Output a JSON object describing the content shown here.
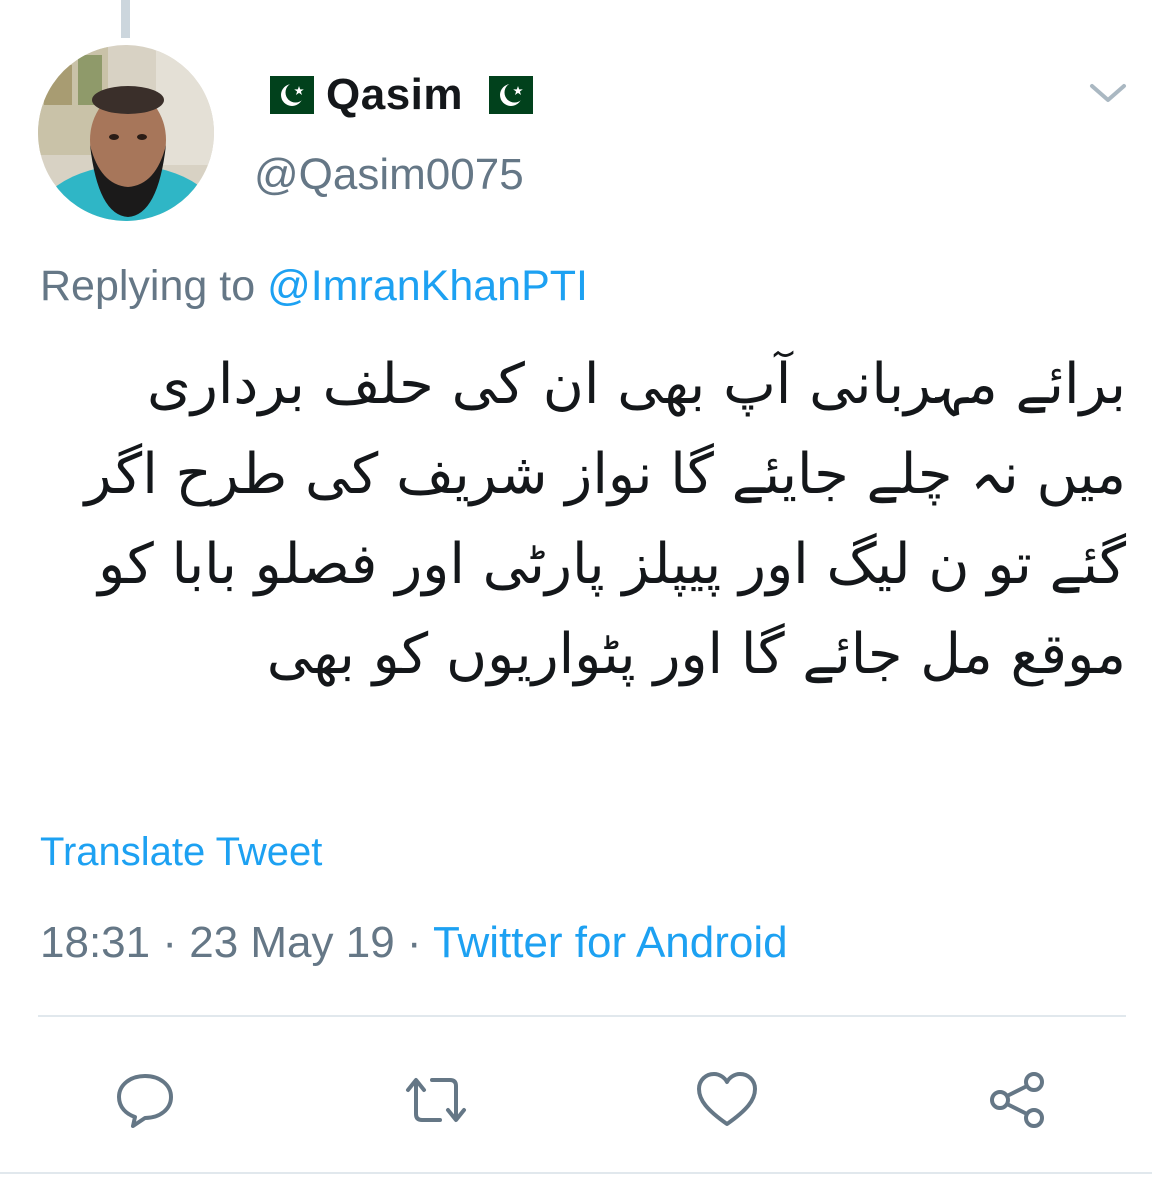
{
  "tweet": {
    "display_name": "Qasim",
    "name_flag_icon": "pakistan-flag-icon",
    "handle": "@Qasim0075",
    "replying_prefix": "Replying to ",
    "replying_to": "@ImranKhanPTI",
    "text": "برائے مہربانی آپ بھی ان کی حلف برداری میں نہ چلے جایئے گا نواز شریف کی طرح اگر گئے تو ن لیگ اور پیپلز پارٹی اور فصلو بابا کو موقع مل جائے گا اور پٹواریوں کو بھی",
    "translate_label": "Translate Tweet",
    "time": "18:31",
    "date": "23 May 19",
    "separator": " · ",
    "source": "Twitter for Android"
  },
  "actions": [
    {
      "name": "reply",
      "icon": "reply-icon"
    },
    {
      "name": "retweet",
      "icon": "retweet-icon"
    },
    {
      "name": "like",
      "icon": "heart-icon"
    },
    {
      "name": "share",
      "icon": "share-icon"
    }
  ],
  "colors": {
    "link": "#1da1f2",
    "secondary_text": "#657786",
    "primary_text": "#14171a",
    "divider": "#e1e8ed"
  }
}
